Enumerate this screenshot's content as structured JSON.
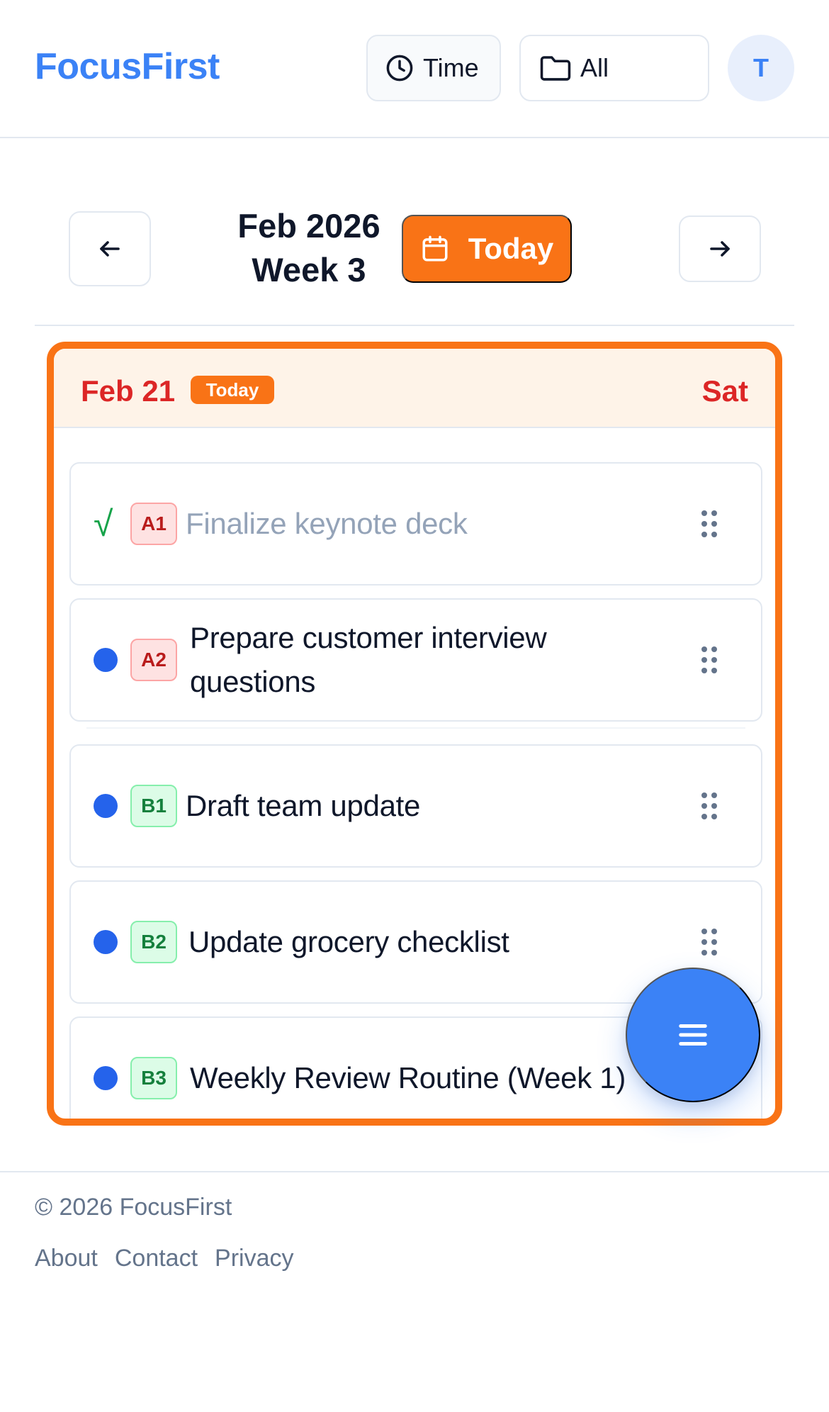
{
  "app": {
    "brand": "FocusFirst",
    "avatar_initial": "T"
  },
  "header": {
    "time_label": "Time",
    "filter_label": "All"
  },
  "week_nav": {
    "month": "Feb 2026",
    "week": "Week 3",
    "today_label": "Today"
  },
  "day": {
    "date": "Feb 21",
    "today_badge": "Today",
    "weekday": "Sat",
    "tasks": [
      {
        "priority": "A1",
        "title": "Finalize keynote deck",
        "done": true,
        "status_glyph": "√"
      },
      {
        "priority": "A2",
        "title": "Prepare customer interview questions",
        "done": false
      },
      {
        "priority": "B1",
        "title": "Draft team update",
        "done": false
      },
      {
        "priority": "B2",
        "title": "Update grocery checklist",
        "done": false
      },
      {
        "priority": "B3",
        "title": "Weekly Review Routine (Week 1)",
        "done": false
      }
    ]
  },
  "footer": {
    "copyright": "© 2026 FocusFirst",
    "links": [
      "About",
      "Contact",
      "Privacy"
    ]
  },
  "colors": {
    "brand": "#3b82f6",
    "accent": "#f97316",
    "date_red": "#dc2626",
    "dot_blue": "#2563eb",
    "priority_a_bg": "#fee2e2",
    "priority_b_bg": "#dcfce7"
  },
  "icons": {
    "time": "clock-icon",
    "filter": "folder-icon",
    "prev": "arrow-left-icon",
    "next": "arrow-right-icon",
    "today": "calendar-icon",
    "fab": "menu-icon",
    "drag": "drag-handle-icon"
  }
}
